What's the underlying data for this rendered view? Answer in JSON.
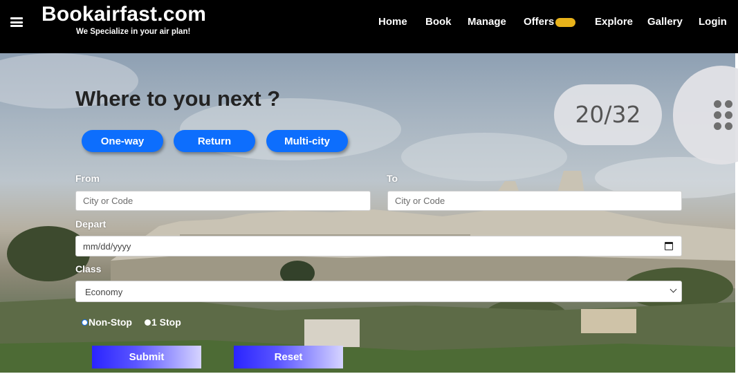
{
  "header": {
    "brand": "Bookairfast.com",
    "tagline": "We Specialize in your air plan!",
    "nav": [
      "Home",
      "Book",
      "Manage",
      "Offers",
      "Explore",
      "Gallery",
      "Login"
    ],
    "menu_icon": "hamburger-menu-icon",
    "offers_badge_color": "#e8b21a"
  },
  "form": {
    "title": "Where to you next ?",
    "trip_types": [
      "One-way",
      "Return",
      "Multi-city"
    ],
    "from_label": "From",
    "from_placeholder": "City or Code",
    "to_label": "To",
    "to_placeholder": "City or Code",
    "depart_label": "Depart",
    "depart_value": "mm/dd/yyyy",
    "class_label": "Class",
    "class_value": "Economy",
    "stops": [
      "Non-Stop",
      "1 Stop"
    ],
    "submit_label": "Submit",
    "reset_label": "Reset"
  },
  "overlay": {
    "counter": "20/32",
    "fab_icon": "dots-grid-icon"
  },
  "colors": {
    "accent": "#0d6efd",
    "header_bg": "#000000",
    "button_gradient": [
      "#2a24ff",
      "#d6d4ff"
    ]
  }
}
